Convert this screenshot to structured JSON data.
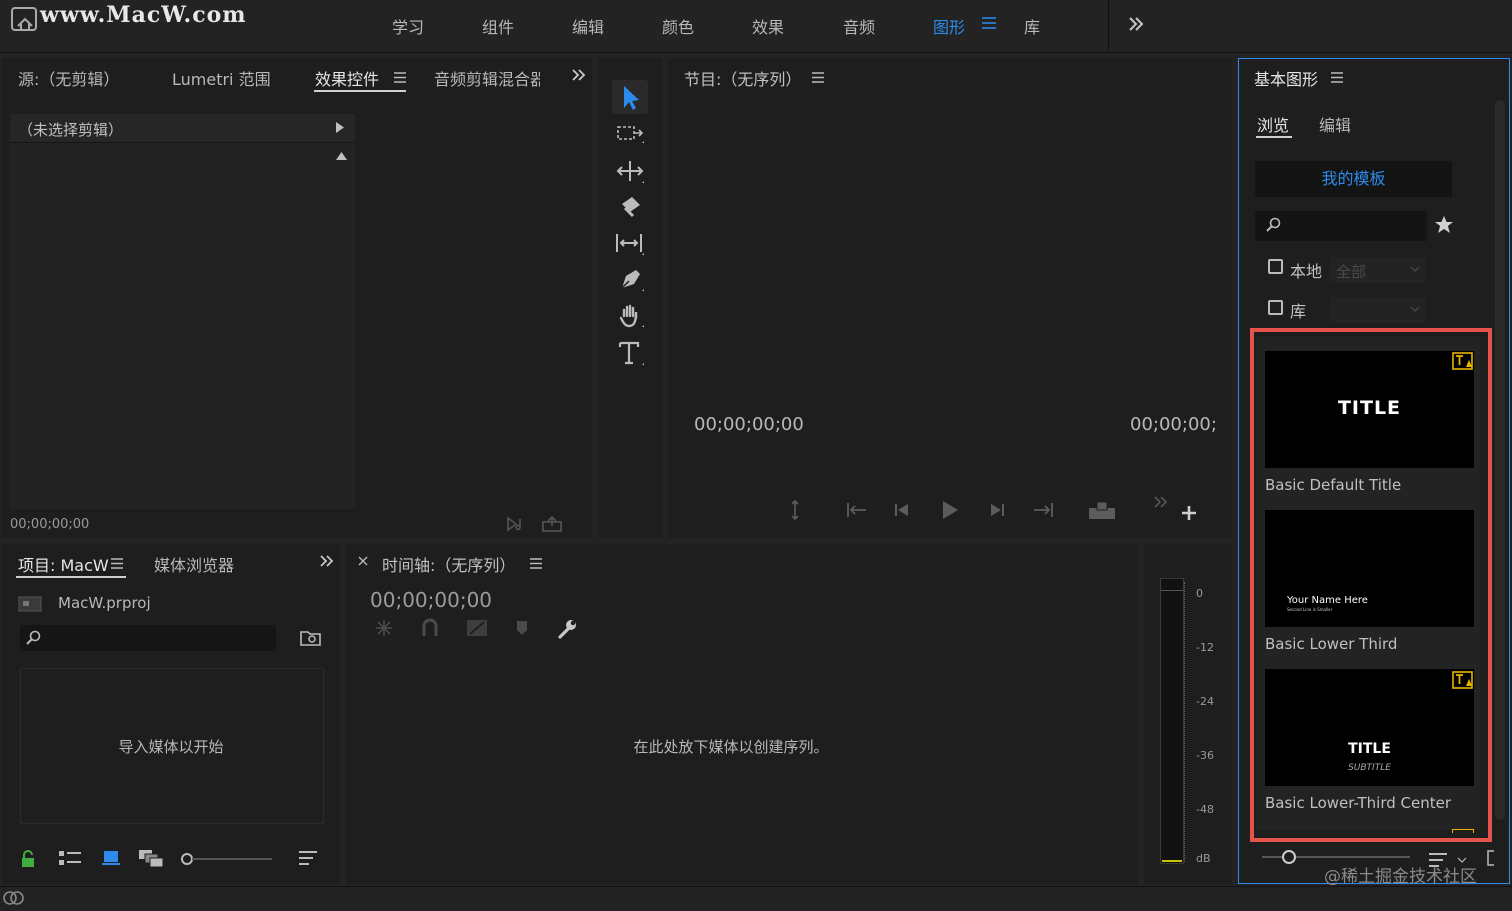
{
  "watermark_top": "www.MacW.com",
  "watermark_bottom": "@稀土掘金技术社区",
  "workspaces": [
    "学习",
    "组件",
    "编辑",
    "颜色",
    "效果",
    "音频",
    "图形",
    "库"
  ],
  "source_panel": {
    "tabs": [
      "源:（无剪辑）",
      "Lumetri 范围",
      "效果控件",
      "音频剪辑混合器"
    ],
    "header": "（未选择剪辑）",
    "timecode": "00;00;00;00"
  },
  "program_panel": {
    "title": "节目:（无序列）",
    "timecode_left": "00;00;00;00",
    "timecode_right": "00;00;00;"
  },
  "project_panel": {
    "tabs": [
      "项目: MacW",
      "媒体浏览器"
    ],
    "file_name": "MacW.prproj",
    "empty_text": "导入媒体以开始"
  },
  "timeline_panel": {
    "title": "时间轴:（无序列）",
    "timecode": "00;00;00;00",
    "empty_text": "在此处放下媒体以创建序列。"
  },
  "audio_meter": {
    "labels": [
      "0",
      "-12",
      "-24",
      "-36",
      "-48",
      "dB"
    ]
  },
  "essential_graphics": {
    "title": "基本图形",
    "tabs": [
      "浏览",
      "编辑"
    ],
    "my_templates": "我的模板",
    "local_label": "本地",
    "local_dropdown": "全部",
    "library_label": "库",
    "templates": [
      {
        "name": "Basic Default Title",
        "thumb_title": "TITLE"
      },
      {
        "name": "Basic Lower Third",
        "thumb_line1": "Your Name Here",
        "thumb_line2": "Second Line is Smaller"
      },
      {
        "name": "Basic Lower-Third Center",
        "thumb_title": "TITLE",
        "thumb_subtitle": "SUBTITLE"
      }
    ]
  },
  "colors": {
    "accent_blue": "#2d8ceb",
    "highlight_red": "#e5534b",
    "warning_yellow": "#e8b400"
  }
}
